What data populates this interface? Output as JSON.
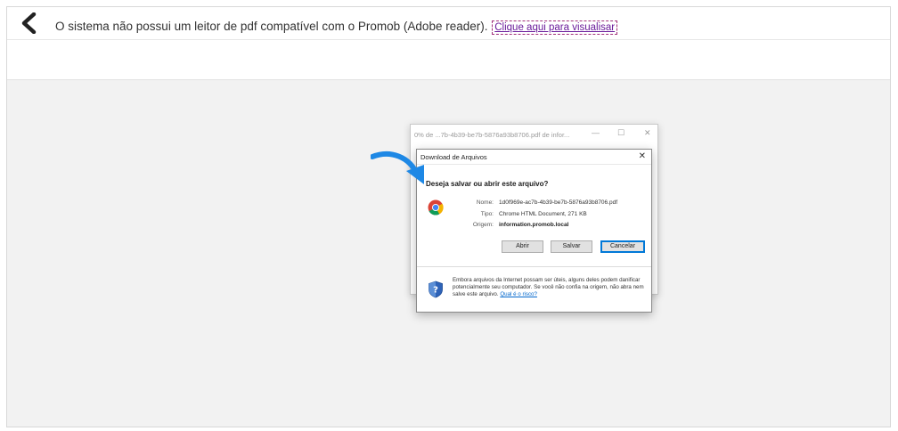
{
  "header": {
    "message": "O sistema não possui um leitor de pdf compatível com o Promob (Adobe reader).",
    "link": "Clique aqui para visualisar"
  },
  "background_window": {
    "title": "0% de ...7b-4b39-be7b-5876a93b8706.pdf de infor...",
    "minimize": "—",
    "maximize": "☐",
    "close": "✕"
  },
  "dialog": {
    "title": "Download de Arquivos",
    "close": "✕",
    "question": "Deseja salvar ou abrir este arquivo?",
    "name_label": "Nome:",
    "name_value": "1d0f969e-ac7b-4b39-be7b-5876a93b8706.pdf",
    "type_label": "Tipo:",
    "type_value": "Chrome HTML Document, 271 KB",
    "origin_label": "Origem:",
    "origin_value": "information.promob.local",
    "buttons": {
      "open": "Abrir",
      "save": "Salvar",
      "cancel": "Cancelar"
    },
    "warning": "Embora arquivos da Internet possam ser úteis, alguns deles podem danificar potencialmente seu computador. Se você não confia na origem, não abra nem salve este arquivo.",
    "risk_link": "Qual é o risco?"
  },
  "colors": {
    "link_purple": "#6a1b9a",
    "arrow_blue": "#1e88e5",
    "primary_button_border": "#0078d7"
  },
  "icons": [
    "back-chevron-icon",
    "chrome-icon",
    "shield-icon",
    "pointer-arrow-icon"
  ]
}
